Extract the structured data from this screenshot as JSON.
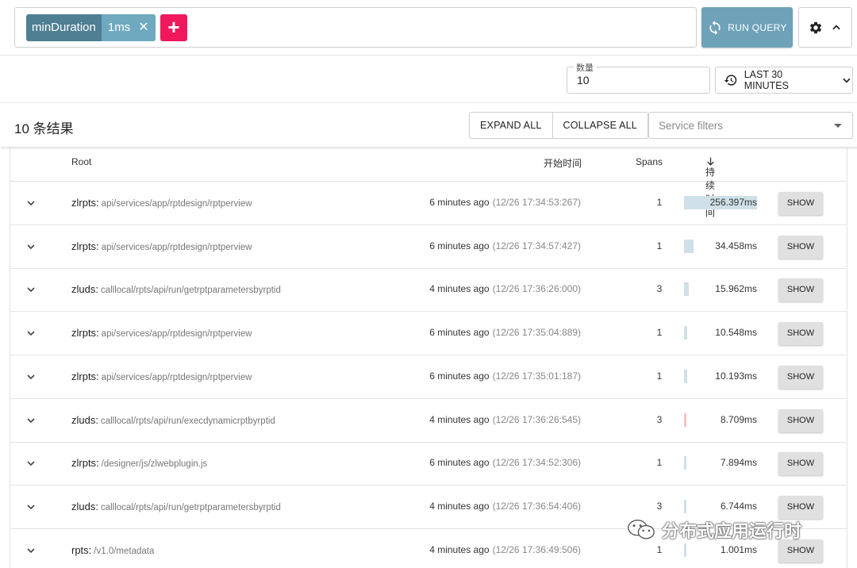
{
  "query": {
    "chip_key": "minDuration",
    "chip_value": "1ms",
    "run_label": "RUN QUERY"
  },
  "limit": {
    "label": "数量",
    "value": "10"
  },
  "lookback": {
    "label": "LAST 30 MINUTES"
  },
  "results": {
    "count_label": "10 条结果",
    "expand_all": "EXPAND ALL",
    "collapse_all": "COLLAPSE ALL",
    "service_filter_placeholder": "Service filters"
  },
  "columns": {
    "root": "Root",
    "start": "开始时间",
    "spans": "Spans",
    "duration": "持续时间"
  },
  "show_label": "SHOW",
  "colors": {
    "bar_blue": "#cfe0e8",
    "bar_red": "#f3c6bf",
    "accent_pink": "#f0185c",
    "run_button": "#6ea2b9"
  },
  "rows": [
    {
      "service": "zlrpts:",
      "path": "api/services/app/rptdesign/rptperview",
      "relative": "6 minutes ago",
      "absolute": "(12/26 17:34:53:267)",
      "spans": "1",
      "duration": "256.397ms",
      "duration_fraction": 1.0,
      "bar_color": "#cfe0e8"
    },
    {
      "service": "zlrpts:",
      "path": "api/services/app/rptdesign/rptperview",
      "relative": "6 minutes ago",
      "absolute": "(12/26 17:34:57:427)",
      "spans": "1",
      "duration": "34.458ms",
      "duration_fraction": 0.134,
      "bar_color": "#cfe0e8"
    },
    {
      "service": "zluds:",
      "path": "calllocal/rpts/api/run/getrptparametersbyrptid",
      "relative": "4 minutes ago",
      "absolute": "(12/26 17:36:26:000)",
      "spans": "3",
      "duration": "15.962ms",
      "duration_fraction": 0.062,
      "bar_color": "#cfe0e8"
    },
    {
      "service": "zlrpts:",
      "path": "api/services/app/rptdesign/rptperview",
      "relative": "6 minutes ago",
      "absolute": "(12/26 17:35:04:889)",
      "spans": "1",
      "duration": "10.548ms",
      "duration_fraction": 0.041,
      "bar_color": "#cfe0e8"
    },
    {
      "service": "zlrpts:",
      "path": "api/services/app/rptdesign/rptperview",
      "relative": "6 minutes ago",
      "absolute": "(12/26 17:35:01:187)",
      "spans": "1",
      "duration": "10.193ms",
      "duration_fraction": 0.04,
      "bar_color": "#cfe0e8"
    },
    {
      "service": "zluds:",
      "path": "calllocal/rpts/api/run/execdynamicrptbyrptid",
      "relative": "4 minutes ago",
      "absolute": "(12/26 17:36:26:545)",
      "spans": "3",
      "duration": "8.709ms",
      "duration_fraction": 0.034,
      "bar_color": "#f3c6bf"
    },
    {
      "service": "zlrpts:",
      "path": "/designer/js/zlwebplugin.js",
      "relative": "6 minutes ago",
      "absolute": "(12/26 17:34:52:306)",
      "spans": "1",
      "duration": "7.894ms",
      "duration_fraction": 0.031,
      "bar_color": "#cfe0e8"
    },
    {
      "service": "zluds:",
      "path": "calllocal/rpts/api/run/getrptparametersbyrptid",
      "relative": "4 minutes ago",
      "absolute": "(12/26 17:36:54:406)",
      "spans": "3",
      "duration": "6.744ms",
      "duration_fraction": 0.026,
      "bar_color": "#cfe0e8"
    },
    {
      "service": "rpts:",
      "path": "/v1.0/metadata",
      "relative": "4 minutes ago",
      "absolute": "(12/26 17:36:49:506)",
      "spans": "1",
      "duration": "1.001ms",
      "duration_fraction": 0.004,
      "bar_color": "#cfe0e8"
    }
  ],
  "watermark": {
    "text": "分布式应用运行时"
  }
}
